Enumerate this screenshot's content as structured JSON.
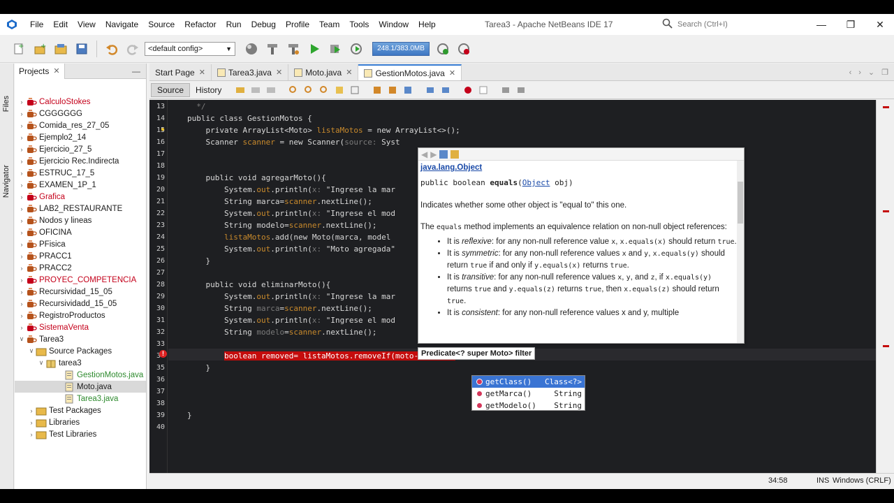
{
  "menu": {
    "items": [
      "File",
      "Edit",
      "View",
      "Navigate",
      "Source",
      "Refactor",
      "Run",
      "Debug",
      "Profile",
      "Team",
      "Tools",
      "Window",
      "Help"
    ],
    "window_title": "Tarea3 - Apache NetBeans IDE 17",
    "search_placeholder": "Search (Ctrl+I)"
  },
  "toolbar": {
    "config": "<default config>",
    "memory": "248.1/383.0MB"
  },
  "side": {
    "files": "Files",
    "navigator": "Navigator"
  },
  "projects": {
    "tab_label": "Projects",
    "items": [
      {
        "label": "CalculoStokes",
        "color": "red"
      },
      {
        "label": "CGGGGGG",
        "color": "black"
      },
      {
        "label": "Comida_res_27_05",
        "color": "black"
      },
      {
        "label": "Ejemplo2_14",
        "color": "black"
      },
      {
        "label": "Ejercicio_27_5",
        "color": "black"
      },
      {
        "label": "Ejercicio Rec.Indirecta",
        "color": "black"
      },
      {
        "label": "ESTRUC_17_5",
        "color": "black"
      },
      {
        "label": "EXAMEN_1P_1",
        "color": "black"
      },
      {
        "label": "Grafica",
        "color": "red"
      },
      {
        "label": "LAB2_RESTAURANTE",
        "color": "black"
      },
      {
        "label": "Nodos y lineas",
        "color": "black"
      },
      {
        "label": "OFICINA",
        "color": "black"
      },
      {
        "label": "PFisica",
        "color": "black"
      },
      {
        "label": "PRACC1",
        "color": "black"
      },
      {
        "label": "PRACC2",
        "color": "black"
      },
      {
        "label": "PROYEC_COMPETENCIA",
        "color": "red"
      },
      {
        "label": "Recursividad_15_05",
        "color": "black"
      },
      {
        "label": "Recursividadd_15_05",
        "color": "black"
      },
      {
        "label": "RegistroProductos",
        "color": "black"
      },
      {
        "label": "SistemaVenta",
        "color": "red"
      },
      {
        "label": "Tarea3",
        "color": "black"
      }
    ],
    "source_packages": "Source Packages",
    "package": "tarea3",
    "files": [
      {
        "label": "GestionMotos.java",
        "color": "green"
      },
      {
        "label": "Moto.java",
        "color": "black"
      },
      {
        "label": "Tarea3.java",
        "color": "green"
      }
    ],
    "test_packages": "Test Packages",
    "libraries": "Libraries",
    "test_libraries": "Test Libraries"
  },
  "editor": {
    "tabs": [
      "Start Page",
      "Tarea3.java",
      "Moto.java",
      "GestionMotos.java"
    ],
    "source_btn": "Source",
    "history_btn": "History",
    "line_numbers": [
      "13",
      "14",
      "15",
      "16",
      "17",
      "18",
      "19",
      "20",
      "21",
      "22",
      "23",
      "24",
      "25",
      "26",
      "27",
      "28",
      "29",
      "30",
      "31",
      "32",
      "33",
      "34",
      "35",
      "36",
      "37",
      "38",
      "39",
      "40"
    ],
    "lines": {
      "l13": "*/",
      "l14": "public class GestionMotos {",
      "l15a": "private ArrayList<Moto> ",
      "l15b": "listaMotos",
      "l15c": " = new ArrayList<>();",
      "l16a": "Scanner ",
      "l16b": "scanner",
      "l16c": " = new Scanner(",
      "l16d": "source: ",
      "l16e": "Syst",
      "l19": "public void agregarMoto(){",
      "l20a": "System.",
      "l20b": "out",
      "l20c": ".println(",
      "l20d": "x: ",
      "l20e": "\"Ingrese la mar",
      "l21a": "String marca=",
      "l21b": "scanner",
      "l21c": ".nextLine();",
      "l22a": "System.",
      "l22b": "out",
      "l22c": ".println(",
      "l22d": "x: ",
      "l22e": "\"Ingrese el mod",
      "l23a": "String modelo=",
      "l23b": "scanner",
      "l23c": ".nextLine();",
      "l24a": "listaMotos",
      "l24b": ".add(new Moto(marca, model",
      "l25a": "System.",
      "l25b": "out",
      "l25c": ".println(",
      "l25d": "x: ",
      "l25e": "\"Moto agregada\"",
      "l26": "}",
      "l28": "public void eliminarMoto(){",
      "l29a": "System.",
      "l29b": "out",
      "l29c": ".println(",
      "l29d": "x: ",
      "l29e": "\"Ingrese la mar",
      "l30a": "String ",
      "l30b": "marca",
      "l30c": "=",
      "l30d": "scanner",
      "l30e": ".nextLine();",
      "l31a": "System.",
      "l31b": "out",
      "l31c": ".println(",
      "l31d": "x: ",
      "l31e": "\"Ingrese el mod",
      "l32a": "String ",
      "l32b": "modelo",
      "l32c": "=",
      "l32d": "scanner",
      "l32e": ".nextLine();",
      "l34": "boolean removed= listaMotos.removeIf(moto-> moto.g",
      "l35": "}",
      "l39": "}"
    }
  },
  "javadoc": {
    "class": "java.lang.Object",
    "sig_pre": "public boolean ",
    "sig_method": "equals",
    "sig_param_type": "Object",
    "sig_post": " obj)",
    "summary": "Indicates whether some other object is \"equal to\" this one.",
    "p2a": "The ",
    "p2code": "equals",
    "p2b": " method implements an equivalence relation on non-null object references:",
    "b1a": "It is ",
    "b1i": "reflexive",
    "b1b": ": for any non-null reference value ",
    "b1c": "x",
    "b1d": ", ",
    "b1e": "x.equals(x)",
    "b1f": " should return ",
    "b1g": "true",
    "b1h": ".",
    "b2a": "It is ",
    "b2i": "symmetric",
    "b2b": ": for any non-null reference values ",
    "b2c": "x",
    "b2d": " and ",
    "b2e": "y",
    "b2f": ", ",
    "b2g": "x.equals(y)",
    "b2h": " should return ",
    "b2j": "true",
    "b2k": " if and only if ",
    "b2l": "y.equals(x)",
    "b2m": " returns ",
    "b2n": "true",
    "b2o": ".",
    "b3a": "It is ",
    "b3i": "transitive",
    "b3b": ": for any non-null reference values ",
    "b3c": "x",
    "b3d": ", ",
    "b3e": "y",
    "b3f": ", and ",
    "b3g": "z",
    "b3h": ", if ",
    "b3j": "x.equals(y)",
    "b3k": " returns ",
    "b3l": "true",
    "b3m": " and ",
    "b3n": "y.equals(z)",
    "b3o": " returns ",
    "b3p": "true",
    "b3q": ", then ",
    "b3r": "x.equals(z)",
    "b3s": " should return ",
    "b3t": "true",
    "b3u": ".",
    "b4a": "It is ",
    "b4i": "consistent",
    "b4b": ": for any non-null reference values x and y, multiple"
  },
  "filter_tip": "Predicate<? super Moto> filter",
  "completion": [
    {
      "name": "getClass()",
      "type": "Class<?>"
    },
    {
      "name": "getMarca()",
      "type": "String"
    },
    {
      "name": "getModelo()",
      "type": "String"
    }
  ],
  "status": {
    "position": "34:58",
    "mode": "INS",
    "line_ending": "Windows (CRLF)"
  }
}
